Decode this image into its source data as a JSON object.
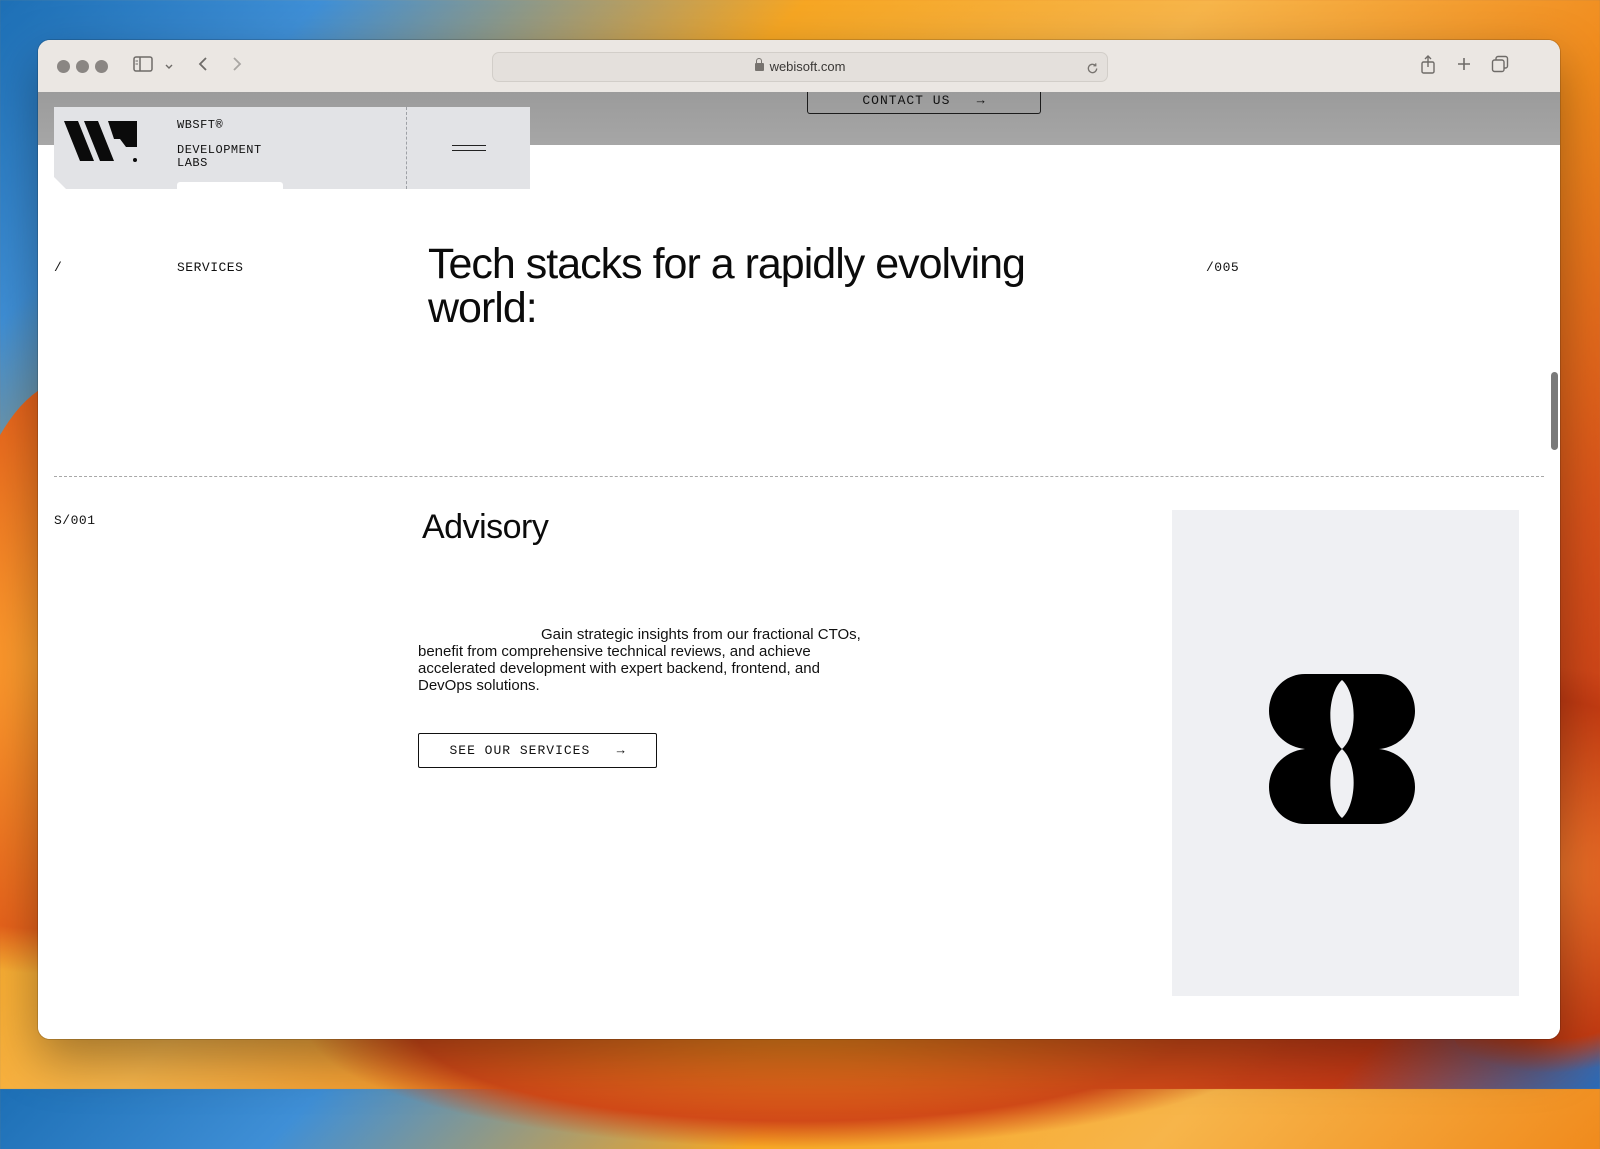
{
  "browser": {
    "url": "webisoft.com"
  },
  "header": {
    "contact_label": "CONTACT US",
    "brand_name": "WBSFT®",
    "brand_sub_line1": "DEVELOPMENT",
    "brand_sub_line2": "LABS"
  },
  "section": {
    "slash": "/",
    "label": "SERVICES",
    "headline": "Tech stacks for a rapidly evolving world:",
    "index": "/005"
  },
  "service": {
    "code": "S/001",
    "title": "Advisory",
    "description": "Gain strategic insights from our fractional CTOs, benefit from comprehensive technical reviews, and achieve accelerated development with expert backend, frontend, and DevOps solutions.",
    "cta_label": "SEE OUR SERVICES"
  },
  "icons": {
    "arrow": "→"
  }
}
